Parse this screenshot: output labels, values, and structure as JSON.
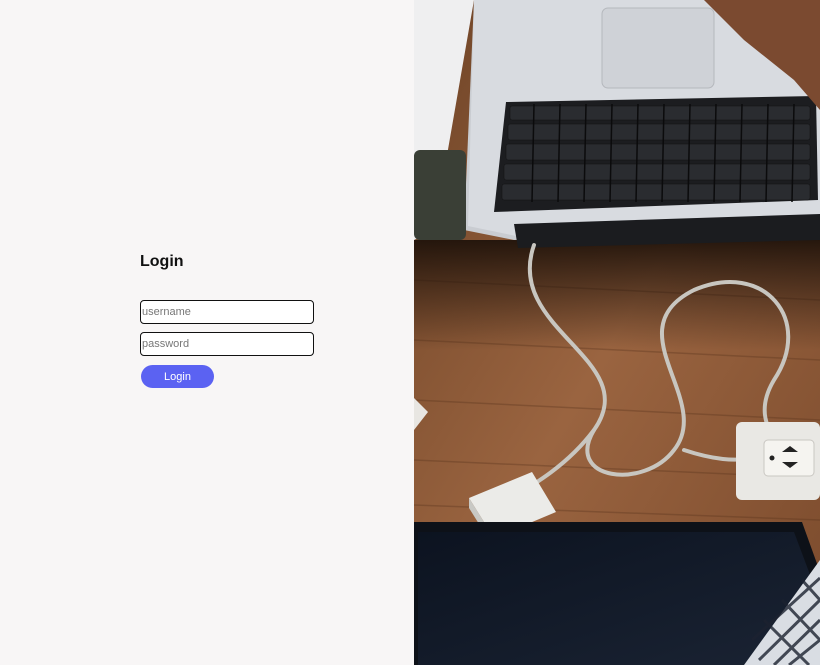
{
  "login": {
    "title": "Login",
    "username_placeholder": "username",
    "password_placeholder": "password",
    "button_label": "Login",
    "button_color": "#5b62f2"
  },
  "hero_image": {
    "subject": "laptops-on-wooden-desk-photo"
  }
}
